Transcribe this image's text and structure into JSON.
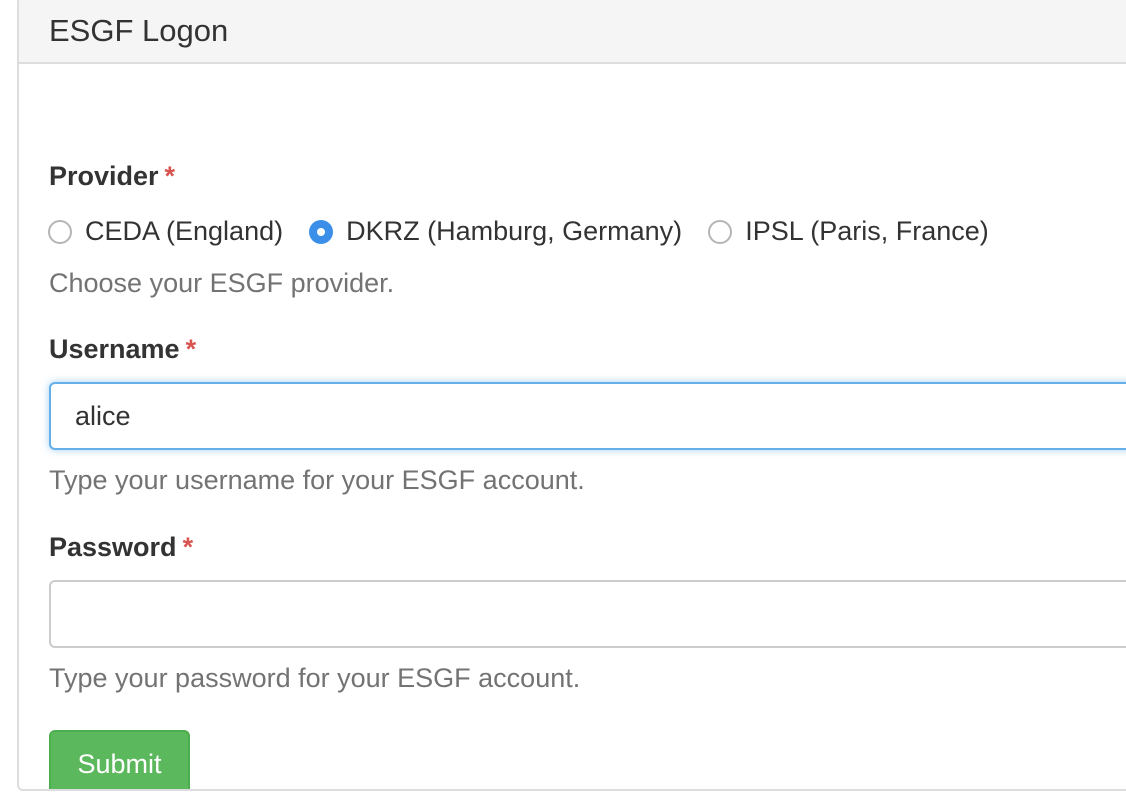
{
  "panel": {
    "title": "ESGF Logon"
  },
  "form": {
    "provider": {
      "label": "Provider",
      "required_mark": "*",
      "options": [
        {
          "label": "CEDA (England)",
          "checked": false
        },
        {
          "label": "DKRZ (Hamburg, Germany)",
          "checked": true
        },
        {
          "label": "IPSL (Paris, France)",
          "checked": false
        }
      ],
      "help": "Choose your ESGF provider."
    },
    "username": {
      "label": "Username",
      "required_mark": "*",
      "value": "alice",
      "help": "Type your username for your ESGF account."
    },
    "password": {
      "label": "Password",
      "required_mark": "*",
      "value": "",
      "help": "Type your password for your ESGF account."
    },
    "submit_label": "Submit"
  },
  "colors": {
    "accent": "#3b8fe8",
    "required": "#d9534f",
    "submit": "#5cb85c",
    "focus": "#66afe9"
  }
}
